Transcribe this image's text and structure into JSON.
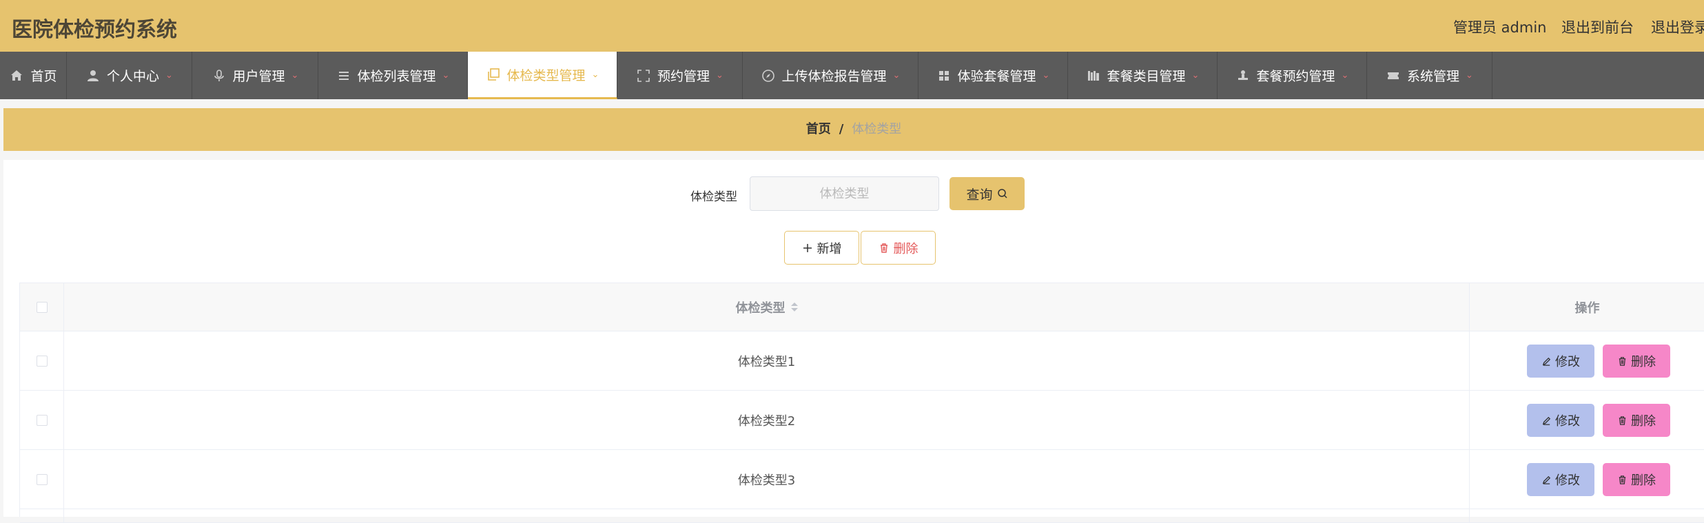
{
  "header": {
    "title": "医院体检预约系统",
    "user_label": "管理员 admin",
    "front_link": "退出到前台",
    "logout_link": "退出登录"
  },
  "nav": {
    "items": [
      {
        "label": "首页",
        "icon": "home-icon",
        "has_dropdown": false,
        "active": false
      },
      {
        "label": "个人中心",
        "icon": "user-icon",
        "has_dropdown": true,
        "active": false
      },
      {
        "label": "用户管理",
        "icon": "microphone-icon",
        "has_dropdown": true,
        "active": false
      },
      {
        "label": "体检列表管理",
        "icon": "list-icon",
        "has_dropdown": true,
        "active": false
      },
      {
        "label": "体检类型管理",
        "icon": "copy-icon",
        "has_dropdown": true,
        "active": true
      },
      {
        "label": "预约管理",
        "icon": "fullscreen-icon",
        "has_dropdown": true,
        "active": false
      },
      {
        "label": "上传体检报告管理",
        "icon": "compass-icon",
        "has_dropdown": true,
        "active": false
      },
      {
        "label": "体验套餐管理",
        "icon": "grid-icon",
        "has_dropdown": true,
        "active": false
      },
      {
        "label": "套餐类目管理",
        "icon": "books-icon",
        "has_dropdown": true,
        "active": false
      },
      {
        "label": "套餐预约管理",
        "icon": "stamp-icon",
        "has_dropdown": true,
        "active": false
      },
      {
        "label": "系统管理",
        "icon": "ticket-icon",
        "has_dropdown": true,
        "active": false
      }
    ]
  },
  "breadcrumb": {
    "home": "首页",
    "separator": "/",
    "current": "体检类型"
  },
  "search": {
    "label": "体检类型",
    "value": "",
    "placeholder": "体检类型",
    "button": "查询"
  },
  "actions": {
    "add": "新增",
    "delete": "删除"
  },
  "table": {
    "columns": {
      "type": "体检类型",
      "ops": "操作"
    },
    "rows": [
      {
        "type": "体检类型1"
      },
      {
        "type": "体检类型2"
      },
      {
        "type": "体检类型3"
      }
    ],
    "edit_label": "修改",
    "delete_label": "删除"
  },
  "colors": {
    "accent": "#e6c36e",
    "nav_bg": "#5b5b5b",
    "active_text": "#e6b94f",
    "edit_btn": "#b3c0ec",
    "delete_btn": "#f687c8",
    "danger_text": "#e45a5a"
  }
}
